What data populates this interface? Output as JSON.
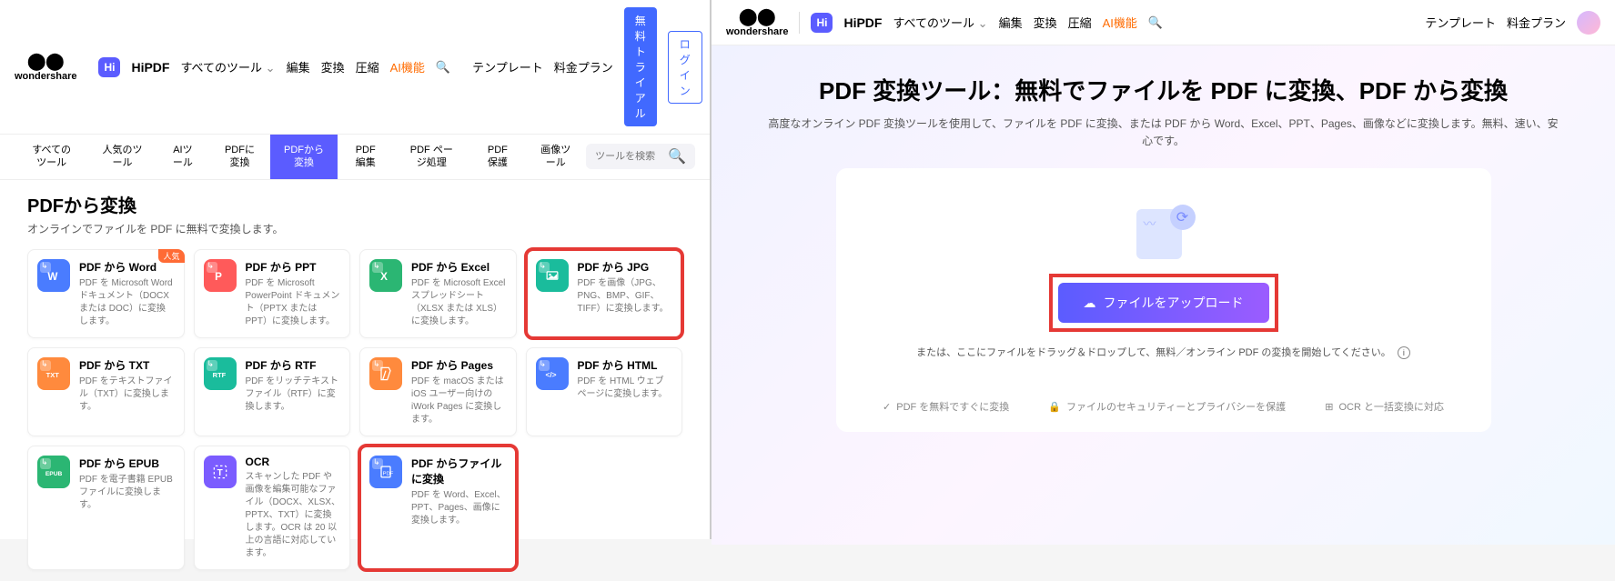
{
  "header": {
    "wondershare": "wondershare",
    "hipdf": "HiPDF",
    "all_tools": "すべてのツール",
    "edit": "編集",
    "convert": "変換",
    "compress": "圧縮",
    "ai": "AI機能",
    "template": "テンプレート",
    "pricing": "料金プラン",
    "trial": "無料トライアル",
    "login": "ログイン"
  },
  "tabs": {
    "t1": "すべてのツール",
    "t2": "人気のツール",
    "t3": "AIツール",
    "t4": "PDFに変換",
    "t5": "PDFから変換",
    "t6": "PDF 編集",
    "t7": "PDF ページ処理",
    "t8": "PDF 保護",
    "t9": "画像ツール",
    "search_ph": "ツールを検索"
  },
  "left": {
    "title": "PDFから変換",
    "sub": "オンラインでファイルを PDF に無料で変換します。",
    "popular": "人気"
  },
  "cards": {
    "word": {
      "title": "PDF から Word",
      "desc": "PDF を Microsoft Word ドキュメント（DOCX または DOC）に変換します。"
    },
    "ppt": {
      "title": "PDF から PPT",
      "desc": "PDF を Microsoft PowerPoint ドキュメント（PPTX または PPT）に変換します。"
    },
    "excel": {
      "title": "PDF から Excel",
      "desc": "PDF を Microsoft Excel スプレッドシート（XLSX または XLS）に変換します。"
    },
    "jpg": {
      "title": "PDF から JPG",
      "desc": "PDF を画像（JPG、PNG、BMP、GIF、TIFF）に変換します。"
    },
    "txt": {
      "title": "PDF から TXT",
      "desc": "PDF をテキストファイル（TXT）に変換します。"
    },
    "rtf": {
      "title": "PDF から RTF",
      "desc": "PDF をリッチテキストファイル（RTF）に変換します。"
    },
    "pages": {
      "title": "PDF から Pages",
      "desc": "PDF を macOS または iOS ユーザー向けの iWork Pages に変換します。"
    },
    "html": {
      "title": "PDF から HTML",
      "desc": "PDF を HTML ウェブページに変換します。"
    },
    "epub": {
      "title": "PDF から EPUB",
      "desc": "PDF を電子書籍 EPUB ファイルに変換します。"
    },
    "ocr": {
      "title": "OCR",
      "desc": "スキャンした PDF や画像を編集可能なファイル（DOCX、XLSX、PPTX、TXT）に変換します。OCR は 20 以上の言語に対応しています。"
    },
    "file": {
      "title": "PDF からファイルに変換",
      "desc": "PDF を Word、Excel、PPT、Pages、画像に変換します。"
    }
  },
  "right": {
    "title": "PDF 変換ツール：無料でファイルを PDF に変換、PDF から変換",
    "sub": "高度なオンライン PDF 変換ツールを使用して、ファイルを PDF に変換、または PDF から Word、Excel、PPT、Pages、画像などに変換します。無料、速い、安心です。",
    "upload": "ファイルをアップロード",
    "drag": "または、ここにファイルをドラッグ＆ドロップして、無料／オンライン PDF の変換を開始してください。",
    "feat1": "PDF を無料ですぐに変換",
    "feat2": "ファイルのセキュリティーとプライバシーを保護",
    "feat3": "OCR と一括変換に対応"
  }
}
